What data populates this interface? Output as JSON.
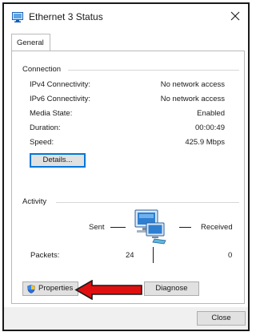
{
  "window": {
    "title": "Ethernet 3 Status"
  },
  "tabs": [
    {
      "label": "General"
    }
  ],
  "connection": {
    "group_label": "Connection",
    "rows": [
      {
        "label": "IPv4 Connectivity:",
        "value": "No network access"
      },
      {
        "label": "IPv6 Connectivity:",
        "value": "No network access"
      },
      {
        "label": "Media State:",
        "value": "Enabled"
      },
      {
        "label": "Duration:",
        "value": "00:00:49"
      },
      {
        "label": "Speed:",
        "value": "425.9 Mbps"
      }
    ],
    "details_button": "Details..."
  },
  "activity": {
    "group_label": "Activity",
    "sent_label": "Sent",
    "received_label": "Received",
    "packets_label": "Packets:",
    "packets_sent": "24",
    "packets_received": "0"
  },
  "buttons": {
    "properties": "Properties",
    "diagnose": "Diagnose",
    "close": "Close"
  },
  "icons": {
    "title": "network-icon",
    "properties": "shield-icon",
    "activity": "network-computers-icon",
    "annotation": "red-arrow-icon"
  },
  "colors": {
    "accent": "#0078d7",
    "annotation_arrow": "#e01010",
    "button_face": "#e1e1e1",
    "footer": "#f0f0f0"
  }
}
